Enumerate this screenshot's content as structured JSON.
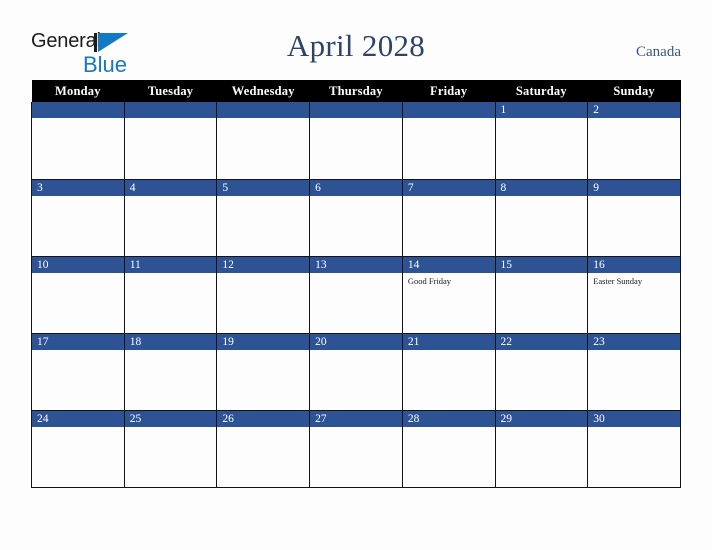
{
  "brand": {
    "word1": "General",
    "word2": "Blue",
    "triangle_icon": "brand-triangle-icon",
    "color_dark": "#1c1c1c",
    "color_blue": "#1479c4"
  },
  "header": {
    "title": "April 2028",
    "country": "Canada",
    "title_color": "#2d4468",
    "country_color": "#3c5483"
  },
  "calendar": {
    "header_bg": "#000000",
    "header_fg": "#ffffff",
    "date_bar_bg": "#2e5395",
    "date_bar_fg": "#ffffff",
    "cell_bg": "#fdfdfd",
    "border_color": "#141414",
    "weekday_headers": [
      "Monday",
      "Tuesday",
      "Wednesday",
      "Thursday",
      "Friday",
      "Saturday",
      "Sunday"
    ],
    "weeks": [
      [
        {
          "date": "",
          "events": []
        },
        {
          "date": "",
          "events": []
        },
        {
          "date": "",
          "events": []
        },
        {
          "date": "",
          "events": []
        },
        {
          "date": "",
          "events": []
        },
        {
          "date": "1",
          "events": []
        },
        {
          "date": "2",
          "events": []
        }
      ],
      [
        {
          "date": "3",
          "events": []
        },
        {
          "date": "4",
          "events": []
        },
        {
          "date": "5",
          "events": []
        },
        {
          "date": "6",
          "events": []
        },
        {
          "date": "7",
          "events": []
        },
        {
          "date": "8",
          "events": []
        },
        {
          "date": "9",
          "events": []
        }
      ],
      [
        {
          "date": "10",
          "events": []
        },
        {
          "date": "11",
          "events": []
        },
        {
          "date": "12",
          "events": []
        },
        {
          "date": "13",
          "events": []
        },
        {
          "date": "14",
          "events": [
            "Good Friday"
          ]
        },
        {
          "date": "15",
          "events": []
        },
        {
          "date": "16",
          "events": [
            "Easter Sunday"
          ]
        }
      ],
      [
        {
          "date": "17",
          "events": []
        },
        {
          "date": "18",
          "events": []
        },
        {
          "date": "19",
          "events": []
        },
        {
          "date": "20",
          "events": []
        },
        {
          "date": "21",
          "events": []
        },
        {
          "date": "22",
          "events": []
        },
        {
          "date": "23",
          "events": []
        }
      ],
      [
        {
          "date": "24",
          "events": []
        },
        {
          "date": "25",
          "events": []
        },
        {
          "date": "26",
          "events": []
        },
        {
          "date": "27",
          "events": []
        },
        {
          "date": "28",
          "events": []
        },
        {
          "date": "29",
          "events": []
        },
        {
          "date": "30",
          "events": []
        }
      ]
    ]
  }
}
